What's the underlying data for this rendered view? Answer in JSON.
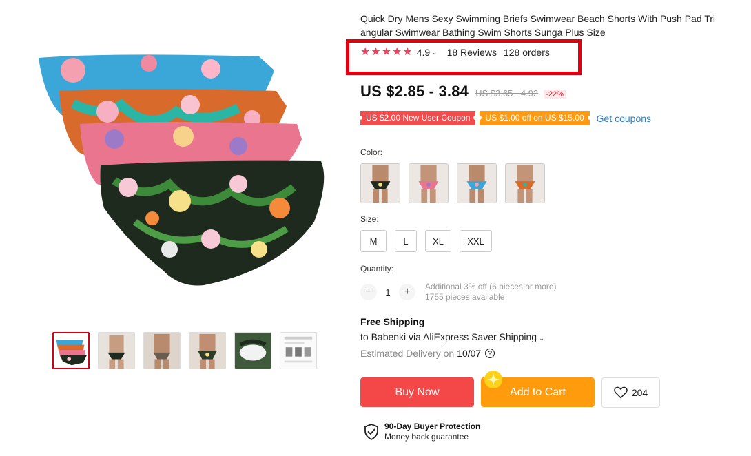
{
  "product": {
    "title_line1": "Quick Dry Mens Sexy Swimming Briefs Swimwear Beach Shorts With Push Pad Tri",
    "title_line2": "angular Swimwear Bathing Swim Shorts Sunga Plus Size"
  },
  "rating": {
    "stars": 5,
    "value": "4.9",
    "reviews": "18 Reviews",
    "orders": "128 orders",
    "highlight_color": "#e0000f"
  },
  "price": {
    "current": "US $2.85 - 3.84",
    "original": "US $3.65 - 4.92",
    "discount": "-22%"
  },
  "coupons": {
    "new_user": "US $2.00 New User Coupon",
    "store": "US $1.00 off on US $15.00",
    "link": "Get coupons"
  },
  "color": {
    "label": "Color:",
    "options": [
      "black-floral",
      "pink-floral",
      "blue-floral",
      "orange-floral"
    ]
  },
  "size": {
    "label": "Size:",
    "options": [
      "M",
      "L",
      "XL",
      "XXL"
    ]
  },
  "quantity": {
    "label": "Quantity:",
    "value": "1",
    "minus": "−",
    "plus": "+",
    "discount_note": "Additional 3% off (6 pieces or more)",
    "available": "1755 pieces available"
  },
  "shipping": {
    "title": "Free Shipping",
    "to": "to Babenki via AliExpress Saver Shipping",
    "delivery_label": "Estimated Delivery on",
    "delivery_date": "10/07",
    "help": "?"
  },
  "actions": {
    "buy_now": "Buy Now",
    "add_to_cart": "Add to Cart",
    "wish_count": "204"
  },
  "protection": {
    "title": "90-Day Buyer Protection",
    "subtitle": "Money back guarantee"
  },
  "colors": {
    "buy": "#f44848",
    "cart": "#ff9b0c",
    "star": "#f0405a",
    "link": "#2e7ec8"
  }
}
